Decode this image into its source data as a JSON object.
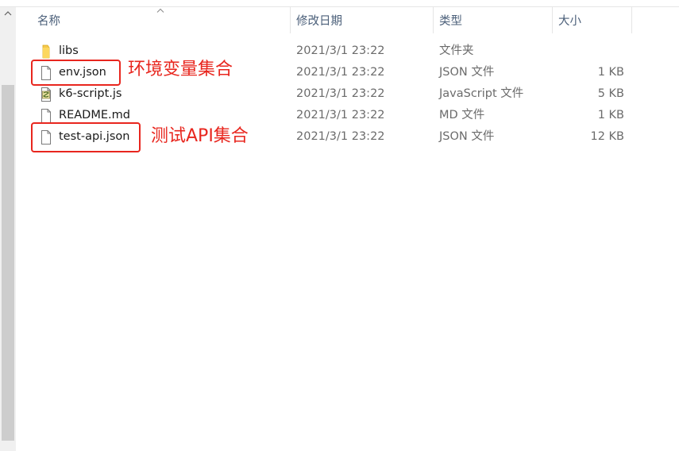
{
  "columns": {
    "name": "名称",
    "date": "修改日期",
    "type": "类型",
    "size": "大小"
  },
  "files": [
    {
      "name": "libs",
      "date": "2021/3/1 23:22",
      "type": "文件夹",
      "size": "",
      "icon": "folder-icon"
    },
    {
      "name": "env.json",
      "date": "2021/3/1 23:22",
      "type": "JSON 文件",
      "size": "1 KB",
      "icon": "file-icon"
    },
    {
      "name": "k6-script.js",
      "date": "2021/3/1 23:22",
      "type": "JavaScript 文件",
      "size": "5 KB",
      "icon": "script-file-icon"
    },
    {
      "name": "README.md",
      "date": "2021/3/1 23:22",
      "type": "MD 文件",
      "size": "1 KB",
      "icon": "file-icon"
    },
    {
      "name": "test-api.json",
      "date": "2021/3/1 23:22",
      "type": "JSON 文件",
      "size": "12 KB",
      "icon": "file-icon"
    }
  ],
  "annotations": {
    "env": "环境变量集合",
    "test_api": "测试API集合"
  },
  "colors": {
    "annotation": "#e8261e",
    "header_text": "#4c607a",
    "folder": "#f5c84c"
  }
}
